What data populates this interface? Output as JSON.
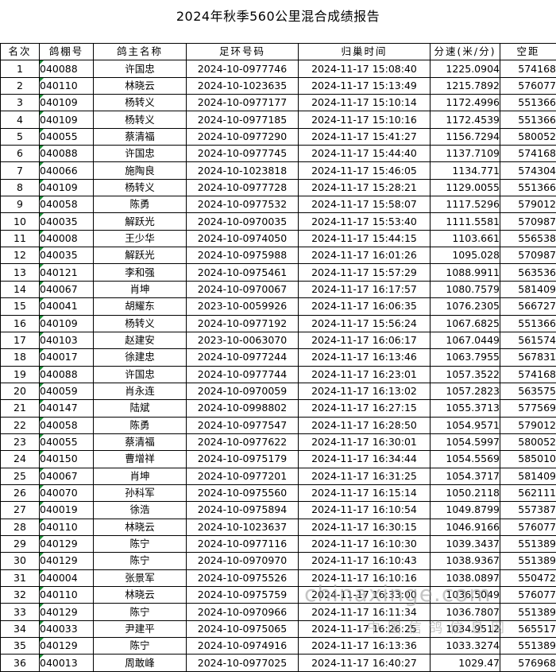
{
  "title": "2024年秋季560公里混合成绩报告",
  "columns": [
    "名次",
    "鸽棚号",
    "鸽主名称",
    "足环号码",
    "归巢时间",
    "分速(米/分)",
    "空距"
  ],
  "rows": [
    [
      "1",
      "040088",
      "许国忠",
      "2024-10-0977746",
      "2024-11-17 15:08:40",
      "1225.0904",
      "574168"
    ],
    [
      "2",
      "040110",
      "林晓云",
      "2024-10-1023635",
      "2024-11-17 15:13:49",
      "1215.7892",
      "576077"
    ],
    [
      "3",
      "040109",
      "杨转义",
      "2024-10-0977177",
      "2024-11-17 15:10:14",
      "1172.4996",
      "551366"
    ],
    [
      "4",
      "040109",
      "杨转义",
      "2024-10-0977185",
      "2024-11-17 15:10:16",
      "1172.4539",
      "551366"
    ],
    [
      "5",
      "040055",
      "蔡清福",
      "2024-10-0977290",
      "2024-11-17 15:41:27",
      "1156.7294",
      "580052"
    ],
    [
      "6",
      "040088",
      "许国忠",
      "2024-10-0977745",
      "2024-11-17 15:44:40",
      "1137.7109",
      "574168"
    ],
    [
      "7",
      "040066",
      "施陶良",
      "2024-10-1023818",
      "2024-11-17 15:46:05",
      "1134.771",
      "574304"
    ],
    [
      "8",
      "040109",
      "杨转义",
      "2024-10-0977728",
      "2024-11-17 15:28:21",
      "1129.0055",
      "551366"
    ],
    [
      "9",
      "040058",
      "陈勇",
      "2024-10-0977532",
      "2024-11-17 15:58:07",
      "1117.5296",
      "579012"
    ],
    [
      "10",
      "040035",
      "解跃光",
      "2024-10-0970035",
      "2024-11-17 15:53:40",
      "1111.5581",
      "570987"
    ],
    [
      "11",
      "040008",
      "王少华",
      "2024-10-0974050",
      "2024-11-17 15:44:15",
      "1103.661",
      "556538"
    ],
    [
      "12",
      "040035",
      "解跃光",
      "2024-10-0975988",
      "2024-11-17 16:01:26",
      "1095.028",
      "570987"
    ],
    [
      "13",
      "040121",
      "李和强",
      "2024-10-0975461",
      "2024-11-17 15:57:29",
      "1088.9911",
      "563536"
    ],
    [
      "14",
      "040067",
      "肖坤",
      "2024-10-0970067",
      "2024-11-17 16:17:57",
      "1080.7579",
      "581409"
    ],
    [
      "15",
      "040041",
      "胡耀东",
      "2023-10-0059926",
      "2024-11-17 16:06:35",
      "1076.2305",
      "566727"
    ],
    [
      "16",
      "040109",
      "杨转义",
      "2024-10-0977192",
      "2024-11-17 15:56:24",
      "1067.6825",
      "551366"
    ],
    [
      "17",
      "040103",
      "赵建安",
      "2023-10-0063070",
      "2024-11-17 16:06:17",
      "1067.0449",
      "561574"
    ],
    [
      "18",
      "040017",
      "徐建忠",
      "2024-10-0977244",
      "2024-11-17 16:13:46",
      "1063.7955",
      "567831"
    ],
    [
      "19",
      "040088",
      "许国忠",
      "2024-10-0977744",
      "2024-11-17 16:23:01",
      "1057.3522",
      "574168"
    ],
    [
      "20",
      "040059",
      "肖永连",
      "2024-10-0970059",
      "2024-11-17 16:13:02",
      "1057.2823",
      "563575"
    ],
    [
      "21",
      "040147",
      "陆斌",
      "2024-10-0998802",
      "2024-11-17 16:27:15",
      "1055.3713",
      "577569"
    ],
    [
      "22",
      "040058",
      "陈勇",
      "2024-10-0977547",
      "2024-11-17 16:28:50",
      "1054.9571",
      "579012"
    ],
    [
      "23",
      "040055",
      "蔡清福",
      "2024-10-0977622",
      "2024-11-17 16:30:01",
      "1054.5997",
      "580052"
    ],
    [
      "24",
      "040150",
      "曹增祥",
      "2024-10-0975179",
      "2024-11-17 16:34:44",
      "1054.5569",
      "585010"
    ],
    [
      "25",
      "040067",
      "肖坤",
      "2024-10-0977201",
      "2024-11-17 16:31:25",
      "1054.3717",
      "581409"
    ],
    [
      "26",
      "040070",
      "孙科军",
      "2024-10-0975560",
      "2024-11-17 16:15:14",
      "1050.2118",
      "562111"
    ],
    [
      "27",
      "040019",
      "徐浩",
      "2024-10-0975894",
      "2024-11-17 16:10:54",
      "1049.8799",
      "557387"
    ],
    [
      "28",
      "040110",
      "林晓云",
      "2024-10-1023637",
      "2024-11-17 16:30:15",
      "1046.9166",
      "576077"
    ],
    [
      "29",
      "040129",
      "陈宁",
      "2024-10-0977116",
      "2024-11-17 16:10:30",
      "1039.3437",
      "551389"
    ],
    [
      "30",
      "040129",
      "陈宁",
      "2024-10-0970970",
      "2024-11-17 16:10:43",
      "1038.9367",
      "551389"
    ],
    [
      "31",
      "040004",
      "张景军",
      "2024-10-0975526",
      "2024-11-17 16:10:16",
      "1038.0897",
      "550472"
    ],
    [
      "32",
      "040110",
      "林晓云",
      "2024-10-0975759",
      "2024-11-17 16:33:00",
      "1036.5049",
      "576077"
    ],
    [
      "33",
      "040129",
      "陈宁",
      "2024-10-0970966",
      "2024-11-17 16:11:34",
      "1036.7807",
      "551389"
    ],
    [
      "34",
      "040033",
      "尹建平",
      "2024-10-0975065",
      "2024-11-17 16:26:25",
      "1034.9512",
      "565517"
    ],
    [
      "35",
      "040129",
      "陈宁",
      "2024-10-0974916",
      "2024-11-17 16:13:36",
      "1033.3274",
      "551389"
    ],
    [
      "36",
      "040013",
      "周敢峰",
      "2024-10-0977025",
      "2024-11-17 16:40:27",
      "1029.47",
      "576968"
    ]
  ],
  "watermark": {
    "line1": "chinaxinge.com",
    "line2": "中国信鸽信息网"
  }
}
